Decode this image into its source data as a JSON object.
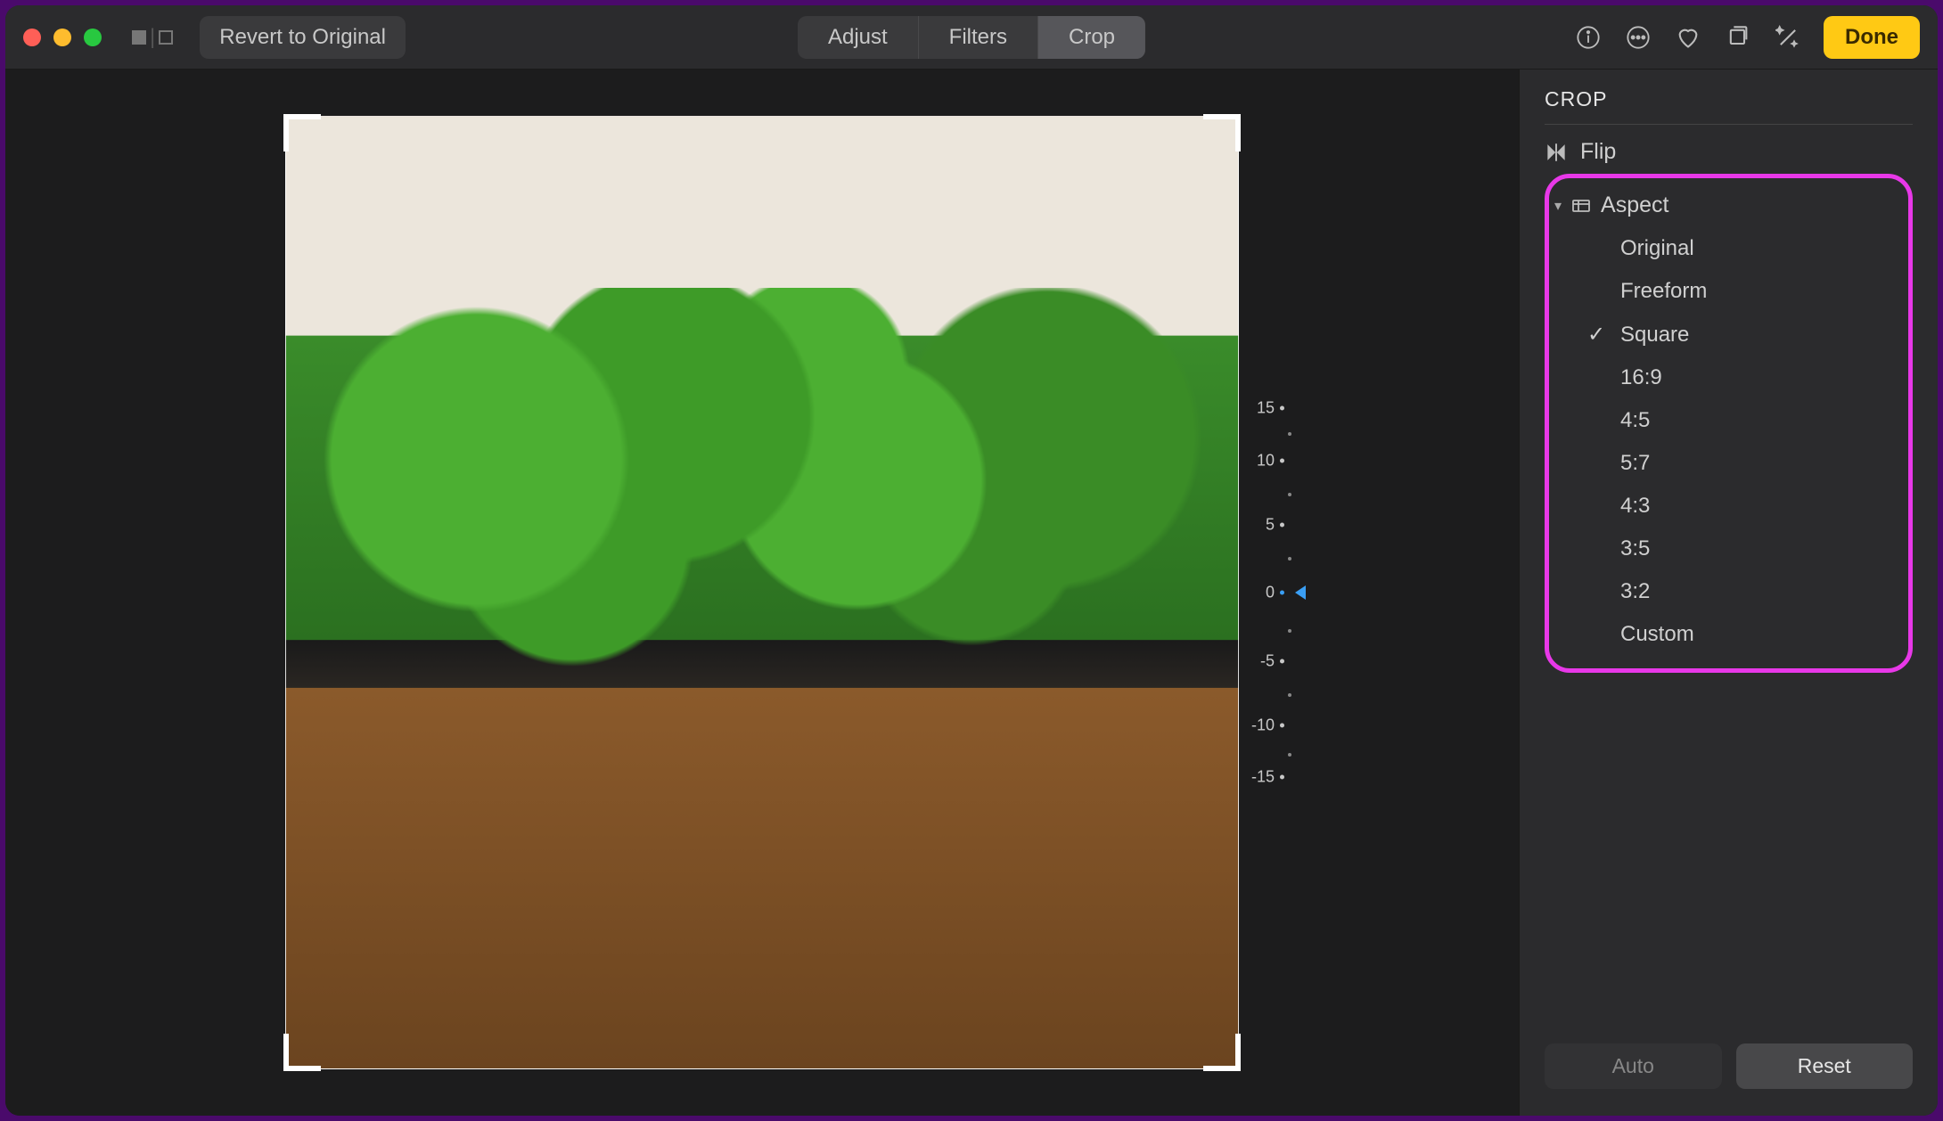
{
  "toolbar": {
    "revert_label": "Revert to Original",
    "tabs": {
      "adjust": "Adjust",
      "filters": "Filters",
      "crop": "Crop"
    },
    "done_label": "Done"
  },
  "crop": {
    "panel_title": "CROP",
    "flip_label": "Flip",
    "aspect_label": "Aspect",
    "aspect_options": {
      "original": "Original",
      "freeform": "Freeform",
      "square": "Square",
      "r16_9": "16:9",
      "r4_5": "4:5",
      "r5_7": "5:7",
      "r4_3": "4:3",
      "r3_5": "3:5",
      "r3_2": "3:2",
      "custom": "Custom"
    },
    "selected_aspect": "square"
  },
  "dial": {
    "ticks": {
      "p15": "15",
      "p10": "10",
      "p5": "5",
      "zero": "0",
      "n5": "-5",
      "n10": "-10",
      "n15": "-15"
    },
    "value": 0
  },
  "footer": {
    "auto_label": "Auto",
    "reset_label": "Reset"
  },
  "colors": {
    "accent_yellow": "#ffc914",
    "highlight_magenta": "#e838e8",
    "dial_pointer": "#3a9ff5"
  }
}
